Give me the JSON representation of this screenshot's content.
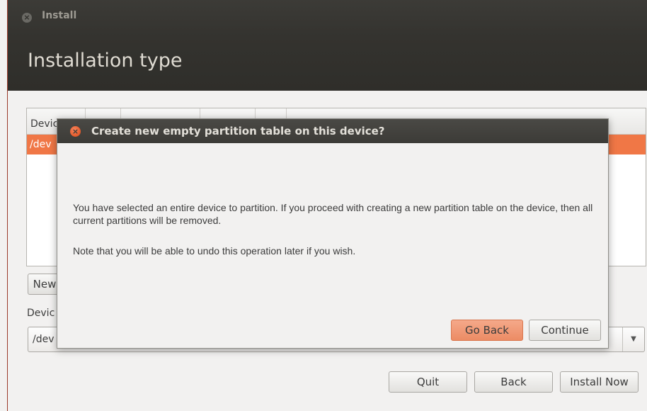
{
  "window": {
    "title": "Install",
    "close_icon": "close-icon",
    "page_title": "Installation type"
  },
  "partition_table": {
    "header_first_column": "Devic",
    "selected_row_text": "/dev"
  },
  "buttons": {
    "new": "New",
    "quit": "Quit",
    "back": "Back",
    "install_now": "Install Now"
  },
  "boot_loader": {
    "label": "Devic",
    "selected_value": "/dev"
  },
  "dialog": {
    "title": "Create new empty partition table on this device?",
    "message": "You have selected an entire device to partition. If you proceed with creating a new partition table on the device, then all current partitions will be removed.",
    "note": "Note that you will be able to undo this operation later if you wish.",
    "go_back": "Go Back",
    "continue": "Continue"
  },
  "colors": {
    "accent": "#f07746",
    "titlebar": "#3c3b37",
    "close_button": "#dd4814"
  }
}
